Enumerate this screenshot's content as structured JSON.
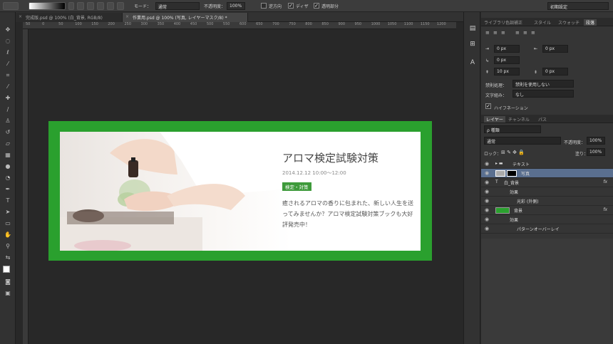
{
  "options_bar": {
    "mode_label": "モード：",
    "mode_value": "通常",
    "opacity_label": "不透明度：",
    "opacity_value": "100%",
    "reverse_label": "逆方向",
    "dither_label": "ディザ",
    "transparency_label": "透明部分",
    "workspace_value": "初期設定"
  },
  "tabs": [
    {
      "label": "完成版.psd @ 100% (白_背景, RGB/8)",
      "active": false
    },
    {
      "label": "作業用.psd @ 100% (写真, レイヤーマスク/8) *",
      "active": true
    }
  ],
  "ruler_labels": [
    "50",
    "0",
    "50",
    "100",
    "150",
    "200",
    "250",
    "300",
    "350",
    "400",
    "450",
    "500",
    "550",
    "600",
    "650",
    "700",
    "750",
    "800",
    "850",
    "900",
    "950",
    "1000",
    "1050",
    "1100",
    "1150",
    "1200"
  ],
  "banner": {
    "title": "アロマ検定試験対策",
    "date": "2014.12.12 10:00〜12:00",
    "tag": "検定・対策",
    "body": "癒されるアロマの香りに包まれた、新しい人生を送ってみませんか？アロマ検定試験対策ブックも大好評発売中！"
  },
  "panel_tabs": [
    "ライブラリ",
    "色調補正",
    "スタイル",
    "スウォッチ",
    "段落"
  ],
  "paragraph": {
    "indent_left": "0 px",
    "indent_right": "0 px",
    "indent_first": "0 px",
    "space_before": "10 px",
    "space_after": "0 px",
    "kinsoku_label": "禁則処理：",
    "kinsoku_value": "禁則を使用しない",
    "mojikumi_label": "文字組み：",
    "mojikumi_value": "なし",
    "hyphenation_label": "ハイフネーション"
  },
  "layers_tabs": [
    "レイヤー",
    "チャンネル",
    "パス"
  ],
  "layers": {
    "filter_value": "ρ 種類",
    "blend_value": "通常",
    "opacity_label": "不透明度：",
    "opacity_value": "100%",
    "lock_label": "ロック：",
    "fill_label": "塗り：",
    "fill_value": "100%",
    "rows": [
      {
        "name": "テキスト",
        "type": "group"
      },
      {
        "name": "写真",
        "type": "layer-mask",
        "selected": true
      },
      {
        "name": "白_背景",
        "type": "fx"
      },
      {
        "name": "効果",
        "type": "effect-header"
      },
      {
        "name": "光彩 (外側)",
        "type": "effect"
      },
      {
        "name": "背景",
        "type": "fx"
      },
      {
        "name": "効果",
        "type": "effect-header"
      },
      {
        "name": "パターンオーバーレイ",
        "type": "effect"
      }
    ],
    "fx_symbol": "fx"
  },
  "colors": {
    "accent_green": "#2aa02e",
    "tag_green": "#3e9a3b",
    "selection_blue": "#5a6f8f"
  }
}
